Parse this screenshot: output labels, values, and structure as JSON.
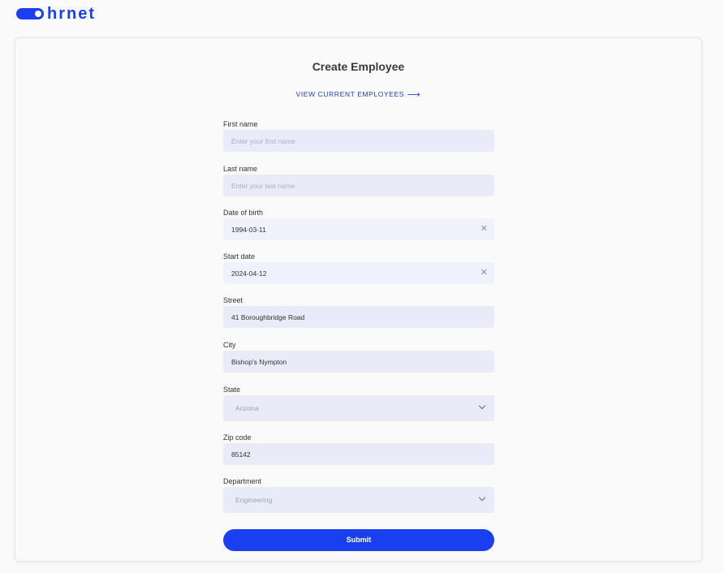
{
  "brand": {
    "logo_text": "hrnet",
    "accent_color": "#1a3ff0"
  },
  "page": {
    "title": "Create Employee",
    "view_link": "VIEW CURRENT EMPLOYEES",
    "view_link_arrow": "⟶"
  },
  "form": {
    "first_name": {
      "label": "First name",
      "placeholder": "Enter your first name",
      "value": ""
    },
    "last_name": {
      "label": "Last name",
      "placeholder": "Enter your last name",
      "value": ""
    },
    "date_of_birth": {
      "label": "Date of birth",
      "value": "1994-03-11",
      "clear_icon": "close-icon"
    },
    "start_date": {
      "label": "Start date",
      "value": "2024-04-12",
      "clear_icon": "close-icon"
    },
    "street": {
      "label": "Street",
      "value": "41 Boroughbridge Road"
    },
    "city": {
      "label": "City",
      "value": "Bishop's Nympton"
    },
    "state": {
      "label": "State",
      "value": "Arizona"
    },
    "zip_code": {
      "label": "Zip code",
      "value": "85142"
    },
    "department": {
      "label": "Department",
      "value": "Engineering"
    },
    "submit_label": "Submit"
  }
}
